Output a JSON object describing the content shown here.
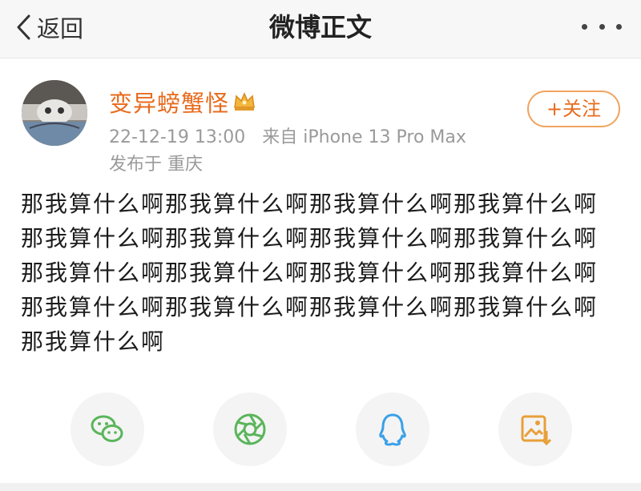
{
  "header": {
    "back_label": "返回",
    "title": "微博正文"
  },
  "author": {
    "name": "变异螃蟹怪",
    "time": "22-12-19 13:00",
    "source": "来自 iPhone 13 Pro Max",
    "location": "发布于 重庆",
    "follow_label": "+关注"
  },
  "post": {
    "text": "那我算什么啊那我算什么啊那我算什么啊那我算什么啊那我算什么啊那我算什么啊那我算什么啊那我算什么啊那我算什么啊那我算什么啊那我算什么啊那我算什么啊那我算什么啊那我算什么啊那我算什么啊那我算什么啊那我算什么啊"
  },
  "share": [
    {
      "icon": "wechat-icon",
      "color": "#5ab55b"
    },
    {
      "icon": "moments-icon",
      "color": "#5ab55b"
    },
    {
      "icon": "qq-icon",
      "color": "#3aa0e8"
    },
    {
      "icon": "save-image-icon",
      "color": "#e8a03a"
    }
  ],
  "colors": {
    "accent": "#e86b1e",
    "meta_text": "#9a9a9a"
  }
}
